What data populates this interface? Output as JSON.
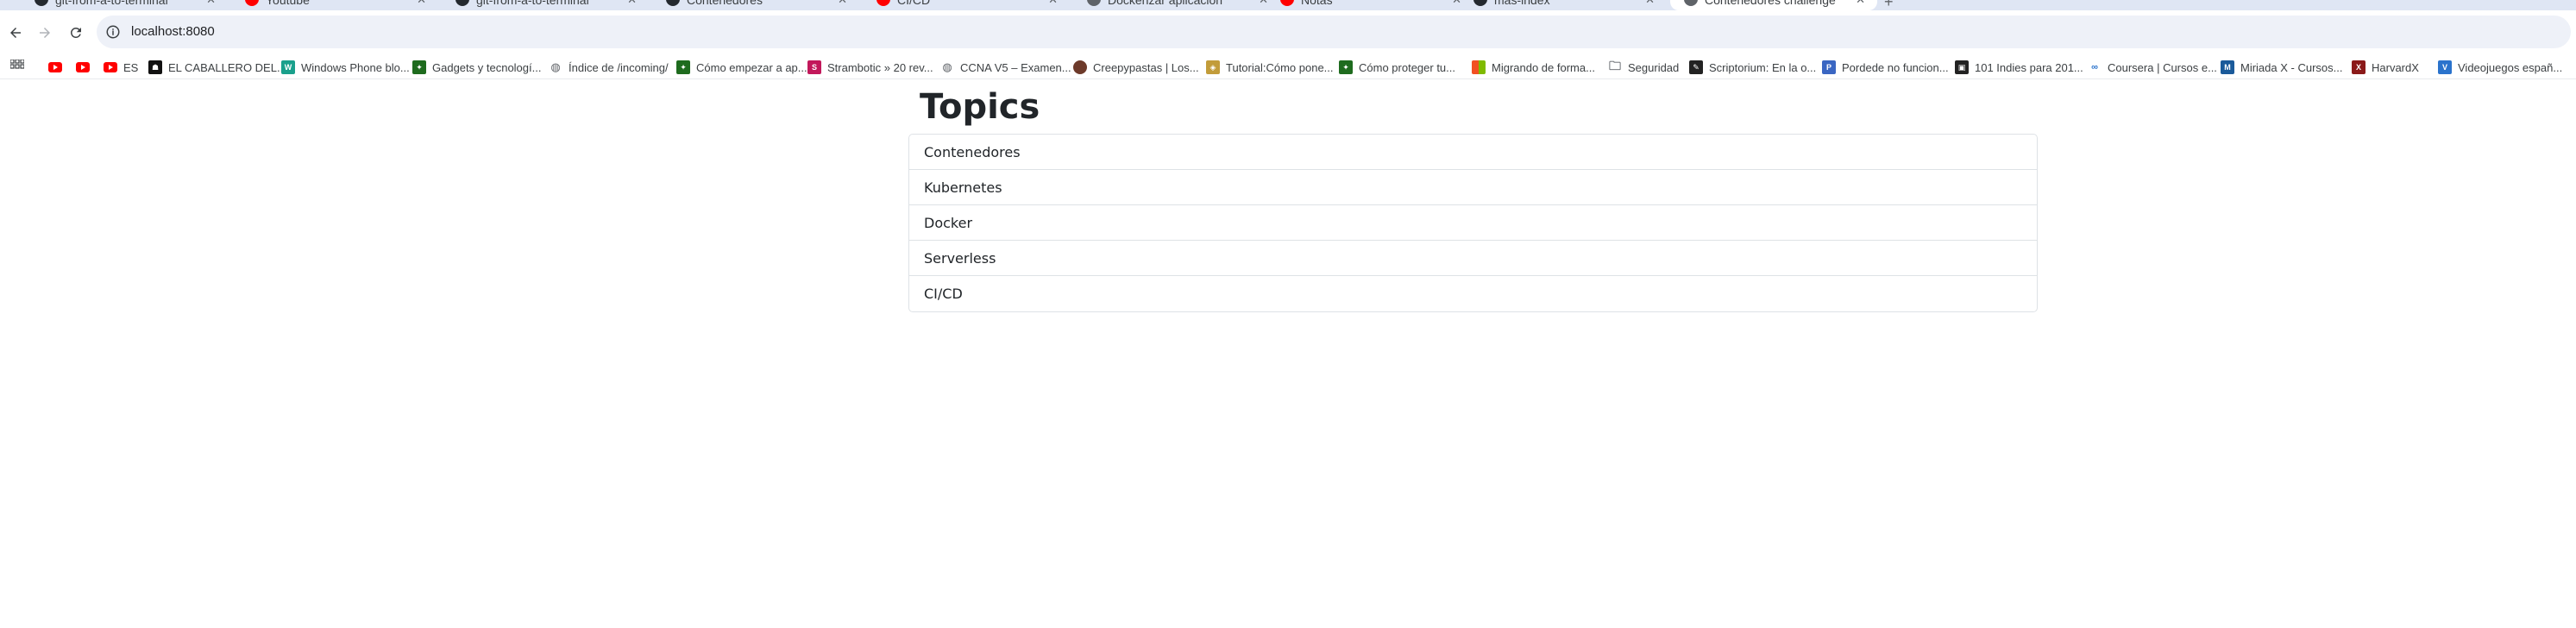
{
  "browser": {
    "tabs": [
      {
        "title": "git-from-a-to-terminal",
        "favicon_color": "#24292f",
        "active": false
      },
      {
        "title": "Youtube",
        "favicon_color": "#ff0000",
        "active": false
      },
      {
        "title": "git-from-a-to-terminal",
        "favicon_color": "#24292f",
        "active": false
      },
      {
        "title": "Contenedores",
        "favicon_color": "#24292f",
        "active": false
      },
      {
        "title": "CI/CD",
        "favicon_color": "#ff0000",
        "active": false
      },
      {
        "title": "Dockerizar aplicacion",
        "favicon_color": "#5f6368",
        "active": false
      },
      {
        "title": "Notas",
        "favicon_color": "#ff0000",
        "active": false
      },
      {
        "title": "mas-index",
        "favicon_color": "#24292f",
        "active": false
      },
      {
        "title": "Contenedores challenge",
        "favicon_color": "#5f6368",
        "active": true
      }
    ],
    "address": {
      "url": "localhost:8080"
    },
    "bookmarks": [
      {
        "label": "",
        "icon": "youtube-icon",
        "color": "#ff0000"
      },
      {
        "label": "",
        "icon": "youtube-icon",
        "color": "#ff0000"
      },
      {
        "label": "ES",
        "icon": "youtube-icon",
        "color": "#ff0000"
      },
      {
        "label": "EL CABALLERO DEL...",
        "icon": "caballero-icon",
        "color": "#111111"
      },
      {
        "label": "Windows Phone blo...",
        "icon": "wpb-icon",
        "color": "#1aa08c"
      },
      {
        "label": "Gadgets y tecnologí...",
        "icon": "gadgets-icon",
        "color": "#1e6b1e"
      },
      {
        "label": "Índice de /incoming/",
        "icon": "globe-icon",
        "color": "#5f6368"
      },
      {
        "label": "Cómo empezar a ap...",
        "icon": "tutorial-icon",
        "color": "#1e6b1e"
      },
      {
        "label": "Strambotic » 20 rev...",
        "icon": "strambotic-icon",
        "color": "#c2185b"
      },
      {
        "label": "CCNA V5 – Examen...",
        "icon": "globe-icon",
        "color": "#5f6368"
      },
      {
        "label": "Creepypastas | Los...",
        "icon": "creepy-icon",
        "color": "#6d3a2a"
      },
      {
        "label": "Tutorial:Cómo pone...",
        "icon": "tutorial2-icon",
        "color": "#c29c3a"
      },
      {
        "label": "Cómo proteger tu...",
        "icon": "proteger-icon",
        "color": "#1e6b1e"
      },
      {
        "label": "Migrando de forma...",
        "icon": "microsoft-icon",
        "color": "#f25022"
      },
      {
        "label": "Seguridad",
        "icon": "folder-icon",
        "color": "#5f6368"
      },
      {
        "label": "Scriptorium: En la o...",
        "icon": "scriptorium-icon",
        "color": "#222222"
      },
      {
        "label": "Pordede no funcion...",
        "icon": "pordede-icon",
        "color": "#3a66c2"
      },
      {
        "label": "101 Indies para 201...",
        "icon": "indies-icon",
        "color": "#222222"
      },
      {
        "label": "Coursera | Cursos e...",
        "icon": "coursera-icon",
        "color": "#2a73cc"
      },
      {
        "label": "Miriada X - Cursos...",
        "icon": "miriada-icon",
        "color": "#1a5a9a"
      },
      {
        "label": "HarvardX",
        "icon": "harvardx-icon",
        "color": "#8b1a1a"
      },
      {
        "label": "Videojuegos españ...",
        "icon": "videojuegos-icon",
        "color": "#2a73cc"
      }
    ]
  },
  "page": {
    "title": "Topics",
    "topics": [
      "Contenedores",
      "Kubernetes",
      "Docker",
      "Serverless",
      "CI/CD"
    ]
  }
}
